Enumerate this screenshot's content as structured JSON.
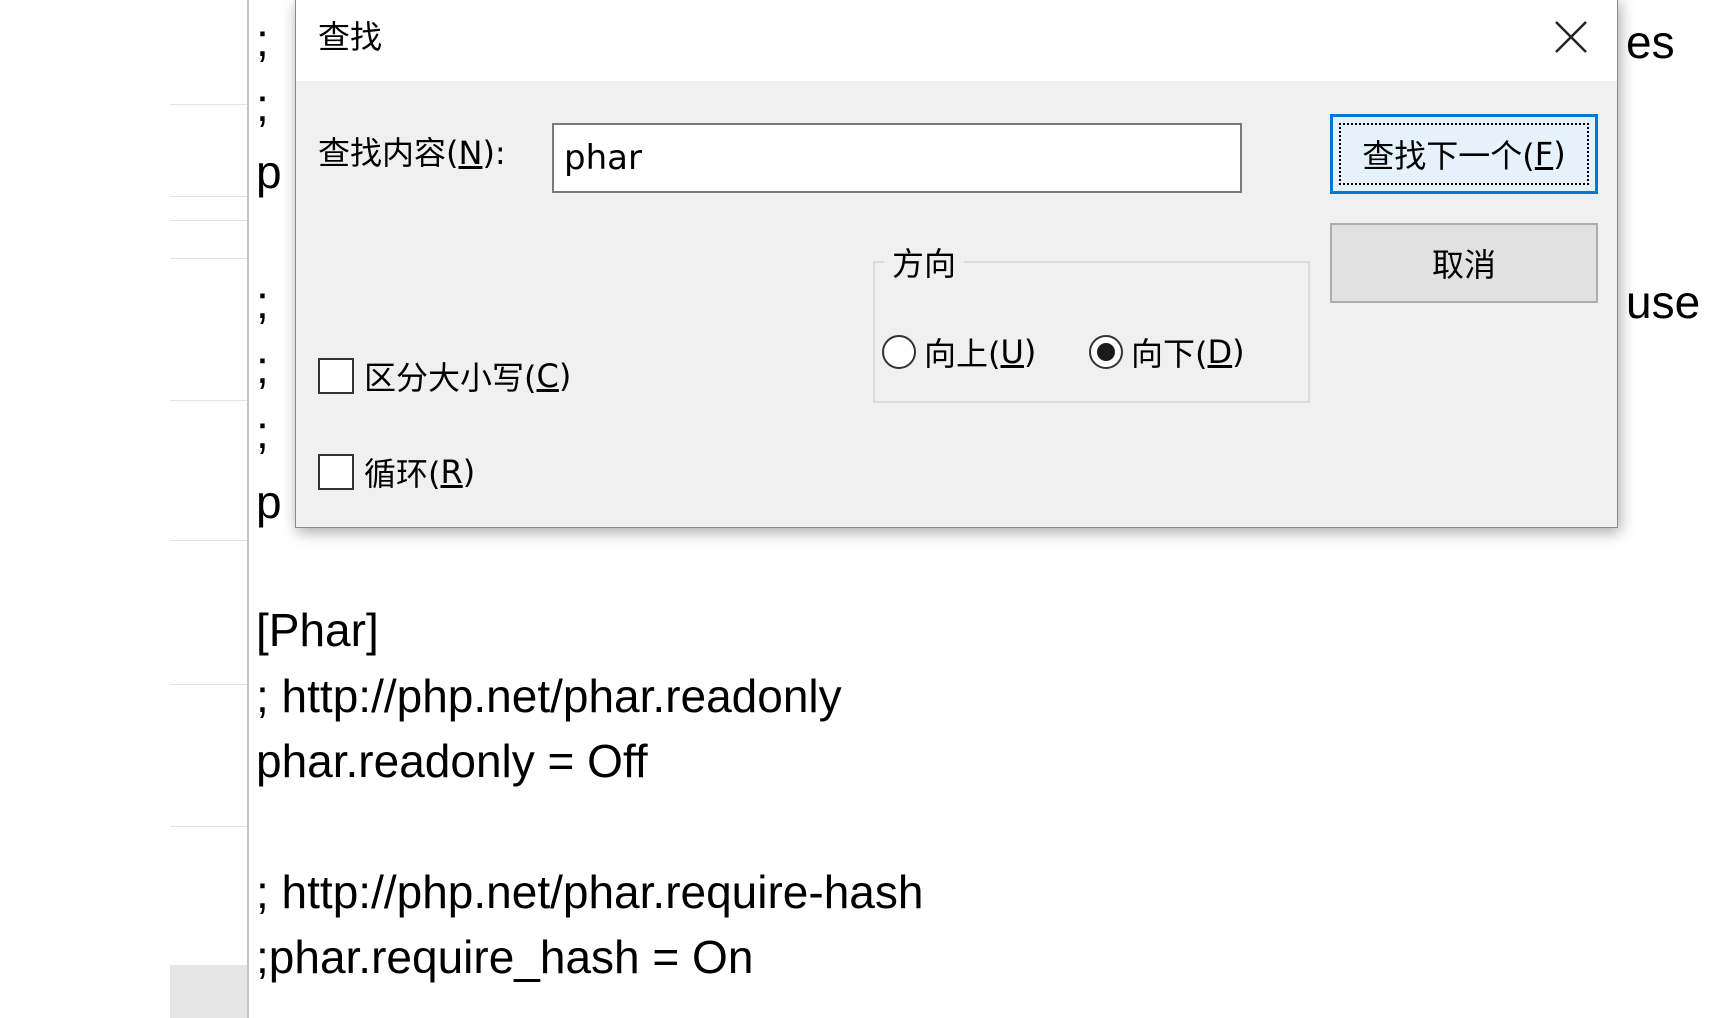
{
  "editor": {
    "lines_visible": [
      "[Phar]",
      "; http://php.net/phar.readonly",
      "phar.readonly = Off",
      "; http://php.net/phar.require-hash",
      ";phar.require_hash = On"
    ],
    "partial_left": [
      ";",
      ";",
      "p",
      ";",
      ";",
      ";",
      "p"
    ],
    "partial_right": [
      "es",
      "use"
    ]
  },
  "dialog": {
    "title": "查找",
    "find_label_prefix": "查找内容(",
    "find_label_key": "N",
    "find_label_suffix": "):",
    "find_value": "phar",
    "find_next_prefix": "查找下一个(",
    "find_next_key": "F",
    "find_next_suffix": ")",
    "cancel_label": "取消",
    "direction": {
      "legend": "方向",
      "up_prefix": "向上(",
      "up_key": "U",
      "up_suffix": ")",
      "down_prefix": "向下(",
      "down_key": "D",
      "down_suffix": ")",
      "selected": "down"
    },
    "match_case": {
      "prefix": "区分大小写(",
      "key": "C",
      "suffix": ")",
      "checked": false
    },
    "wrap": {
      "prefix": "循环(",
      "key": "R",
      "suffix": ")",
      "checked": false
    }
  },
  "colors": {
    "accent": "#0078d7",
    "dialog_bg": "#f0f0f0"
  }
}
